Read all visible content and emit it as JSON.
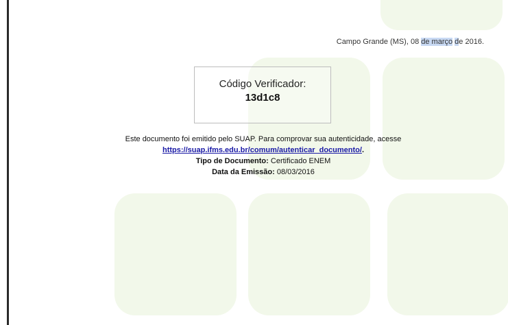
{
  "header": {
    "place_date_pre": "Campo Grande (MS), 08 ",
    "place_date_hl1": "de março",
    "place_date_mid": " ",
    "place_date_hl2": "d",
    "place_date_post": "e 2016."
  },
  "verifier": {
    "label": "Código Verificador:",
    "code": "13d1c8"
  },
  "info": {
    "emitted_text": "Este documento foi emitido pelo SUAP. Para comprovar sua autenticidade, acesse",
    "link": "https://suap.ifms.edu.br/comum/autenticar_documento/",
    "link_suffix": ".",
    "doc_type_label": "Tipo de Documento:",
    "doc_type_value": " Certificado ENEM",
    "emission_label": "Data da Emissão:",
    "emission_value": " 08/03/2016"
  },
  "colors": {
    "tile": "#f2f8ea",
    "link": "#1a1aa6",
    "highlight": "#c8d9f3"
  }
}
